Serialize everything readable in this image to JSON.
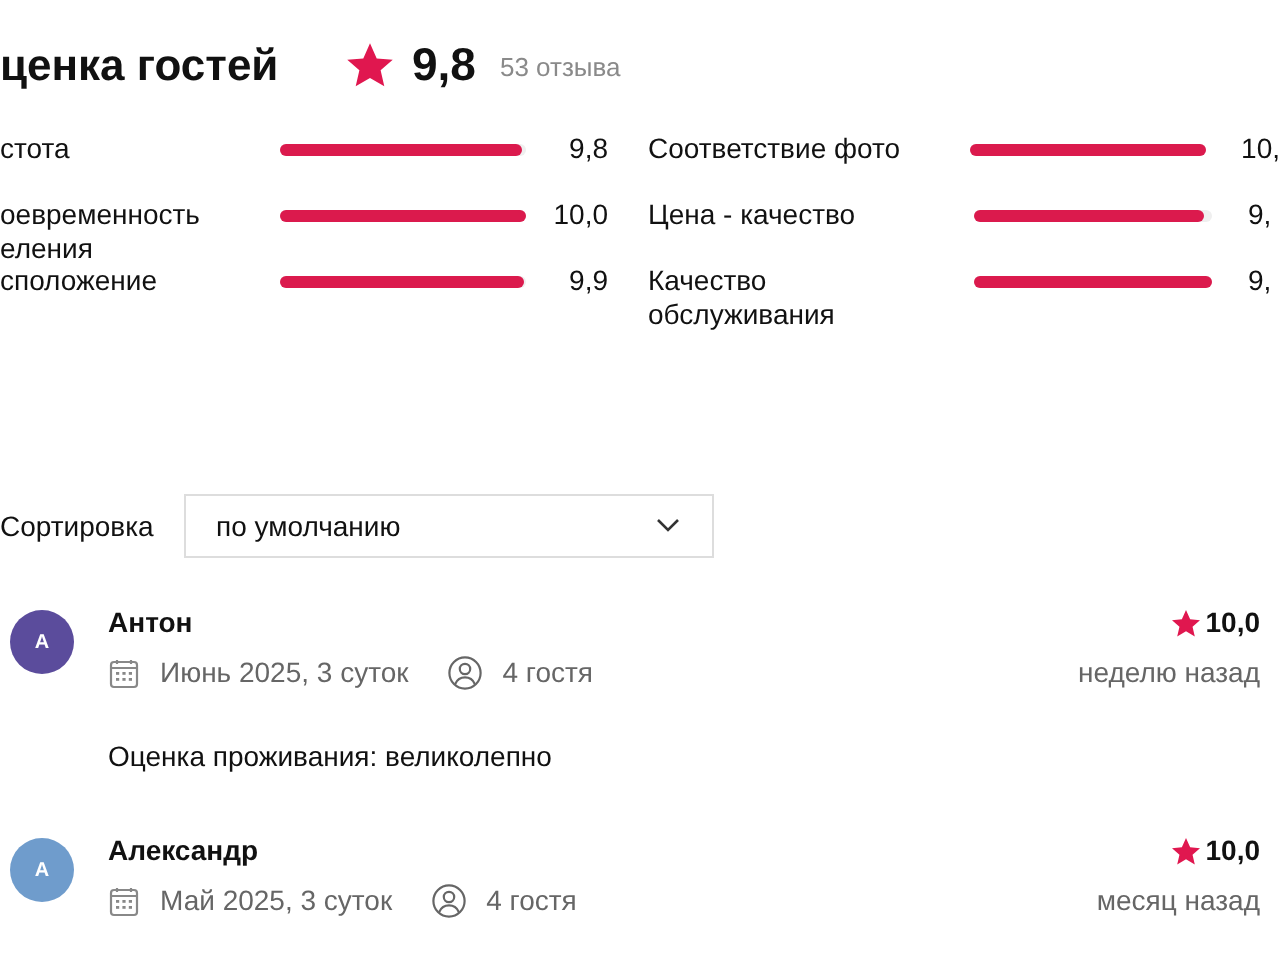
{
  "title": "ценка гостей",
  "overall": {
    "rating": "9,8",
    "count": "53 отзыва"
  },
  "metrics": [
    {
      "label": "стота",
      "level": 0.98,
      "value": "9,8"
    },
    {
      "label": "Соответствие фото",
      "level": 1.0,
      "value": "10,"
    },
    {
      "label": "оевременность\nеления",
      "level": 1.0,
      "value": "10,0"
    },
    {
      "label": "Цена - качество",
      "level": 0.97,
      "value": "9,"
    },
    {
      "label": "сположение",
      "level": 0.99,
      "value": "9,9"
    },
    {
      "label": "Качество обслуживания",
      "level": 1.0,
      "value": "9,"
    }
  ],
  "sort": {
    "label": "Сортировка",
    "value": "по умолчанию"
  },
  "reviews": [
    {
      "initial": "А",
      "color": "#5b4c9c",
      "name": "Антон",
      "stay": "Июнь 2025, 3 суток",
      "guests": "4 гостя",
      "rating": "10,0",
      "ago": "неделю назад",
      "comment": "Оценка проживания: великолепно"
    },
    {
      "initial": "А",
      "color": "#6f9ccc",
      "name": "Александр",
      "stay": "Май 2025, 3 суток",
      "guests": "4 гостя",
      "rating": "10,0",
      "ago": "месяц назад"
    }
  ]
}
